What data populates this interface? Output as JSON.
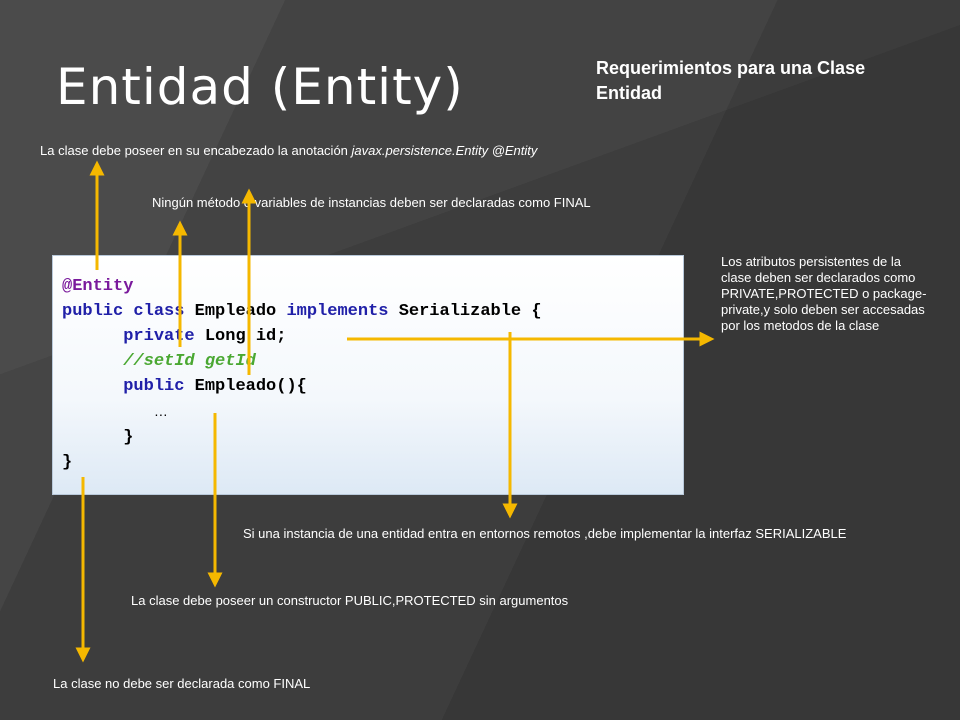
{
  "slide": {
    "title": "Entidad (Entity)",
    "subtitle": "Requerimientos para una Clase Entidad"
  },
  "code": {
    "line1": "@Entity",
    "line2_public": "public",
    "line2_class": "class",
    "line2_name": "Empleado",
    "line2_implements": "implements",
    "line2_iface": "Serializable {",
    "line3_private": "private",
    "line3_rest": "Long id;",
    "line4_comment": "//setId getId",
    "line5_public": "public",
    "line5_rest": "Empleado(){",
    "line6_dots": "…",
    "line7": "}",
    "line8": "}"
  },
  "notes": {
    "anotacion_prefix": "La clase debe poseer en su encabezado la anotación ",
    "anotacion_italic": "javax.persistence.Entity @Entity",
    "final_metodos": "Ningún método o variables de instancias deben ser declaradas como FINAL",
    "atributos": "Los atributos persistentes de la clase deben ser declarados como PRIVATE,PROTECTED o package-private,y solo deben ser accesadas por los metodos de la clase",
    "serializable": "Si una instancia de una entidad entra en entornos remotos ,debe implementar la interfaz SERIALIZABLE",
    "constructor": "La clase debe poseer un constructor PUBLIC,PROTECTED sin argumentos",
    "clase_final": "La clase no debe ser declarada como FINAL"
  },
  "colors": {
    "background": "#3d3d3d",
    "arrow": "#f5b800",
    "keyword": "#2020a8",
    "comment": "#4aa832",
    "annotation": "#7a1a9c"
  }
}
